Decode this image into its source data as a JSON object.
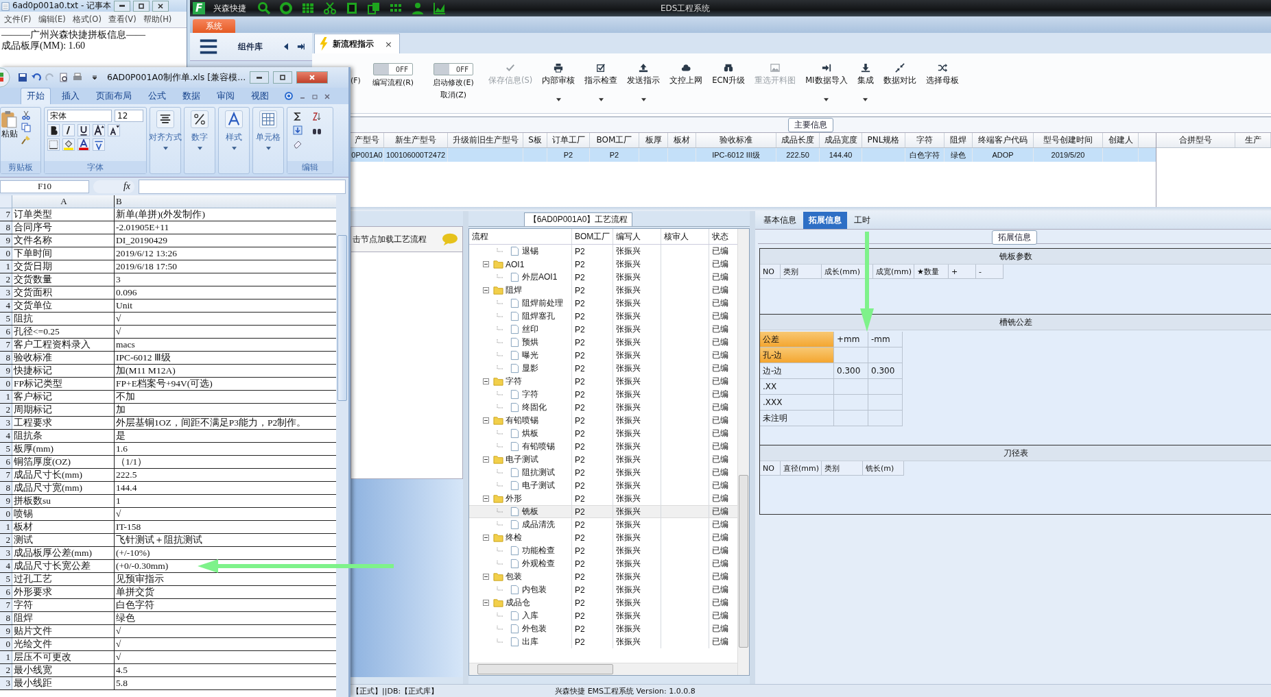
{
  "notepad": {
    "title": "6ad0p001a0.txt - 记事本",
    "menu": [
      "文件(F)",
      "编辑(E)",
      "格式(O)",
      "查看(V)",
      "帮助(H)"
    ],
    "lines": [
      "———广州兴森快捷拼板信息——",
      "成品板厚(MM): 1.60"
    ]
  },
  "app": {
    "logo": "F",
    "brand": "兴森快捷",
    "title": "EDS工程系统",
    "system_tab": "系统",
    "panel_title": "组件库",
    "doc_tab": {
      "label": "新流程指示",
      "close": "×"
    }
  },
  "toolbar": {
    "cut_label": "(F)",
    "toggles": [
      {
        "state": "OFF",
        "on": false,
        "lines": [
          "编写流程(R)"
        ]
      },
      {
        "state": "OFF",
        "on": false,
        "lines": [
          "启动修改(E)",
          "取消(Z)"
        ]
      }
    ],
    "buttons": [
      {
        "label": "保存信息(S)",
        "disabled": true,
        "dropdown": false
      },
      {
        "label": "内部审核",
        "disabled": false,
        "dropdown": true
      },
      {
        "label": "指示检查",
        "disabled": false,
        "dropdown": true
      },
      {
        "label": "发送指示",
        "disabled": false,
        "dropdown": true
      },
      {
        "label": "文控上网",
        "disabled": false,
        "dropdown": false
      },
      {
        "label": "ECN升级",
        "disabled": false,
        "dropdown": false
      },
      {
        "label": "重选开料图",
        "disabled": true,
        "dropdown": false
      },
      {
        "label": "MI数据导入",
        "disabled": false,
        "dropdown": true
      },
      {
        "label": "集成",
        "disabled": false,
        "dropdown": true
      },
      {
        "label": "数据对比",
        "disabled": false,
        "dropdown": false
      },
      {
        "label": "选择母板",
        "disabled": false,
        "dropdown": false
      }
    ]
  },
  "main_info": {
    "title": "主要信息",
    "columns": [
      "产型号",
      "新生产型号",
      "升级前旧生产型号",
      "S板",
      "订单工厂",
      "BOM工厂",
      "板厚",
      "板材",
      "验收标准",
      "成品长度",
      "成品宽度",
      "PNL规格",
      "字符",
      "阻焊",
      "终端客户代码",
      "型号创建时间",
      "创建人"
    ],
    "rows": [
      {
        "selected": true,
        "cells": [
          {
            "value": "0P001A0"
          },
          {
            "value": "100106000T2472"
          },
          {},
          {},
          {
            "value": "P2"
          },
          {
            "value": "P2"
          },
          {},
          {},
          {
            "value": "IPC-6012 III级"
          },
          {
            "value": "222.50"
          },
          {
            "value": "144.40"
          },
          {},
          {
            "value": "白色字符"
          },
          {
            "value": "绿色"
          },
          {
            "value": "ADOP"
          },
          {
            "value": "2019/5/20"
          },
          {}
        ]
      }
    ],
    "side_columns": [
      "合拼型号",
      "生产"
    ]
  },
  "flow_panel": {
    "hint": "击节点加载工艺流程",
    "title": "【6AD0P001A0】工艺流程",
    "columns": [
      "流程",
      "BOM工厂",
      "编写人",
      "核审人",
      "状态"
    ],
    "continued": [
      {
        "label": "退锡",
        "bom": "P2",
        "writer": "张振兴",
        "status": "已编",
        "selected": false
      }
    ],
    "nodes": [
      {
        "label": "AOI1",
        "bom": "P2",
        "writer": "张振兴",
        "status": "已编",
        "selected": false,
        "expanded": true,
        "children": [
          {
            "label": "外层AOI1",
            "bom": "P2",
            "writer": "张振兴",
            "status": "已编",
            "selected": false
          }
        ]
      },
      {
        "label": "阻焊",
        "bom": "P2",
        "writer": "张振兴",
        "status": "已编",
        "selected": false,
        "expanded": true,
        "children": [
          {
            "label": "阻焊前处理",
            "bom": "P2",
            "writer": "张振兴",
            "status": "已编",
            "selected": false
          },
          {
            "label": "阻焊塞孔",
            "bom": "P2",
            "writer": "张振兴",
            "status": "已编",
            "selected": false
          },
          {
            "label": "丝印",
            "bom": "P2",
            "writer": "张振兴",
            "status": "已编",
            "selected": false
          },
          {
            "label": "预烘",
            "bom": "P2",
            "writer": "张振兴",
            "status": "已编",
            "selected": false
          },
          {
            "label": "曝光",
            "bom": "P2",
            "writer": "张振兴",
            "status": "已编",
            "selected": false
          },
          {
            "label": "显影",
            "bom": "P2",
            "writer": "张振兴",
            "status": "已编",
            "selected": false
          }
        ]
      },
      {
        "label": "字符",
        "bom": "P2",
        "writer": "张振兴",
        "status": "已编",
        "selected": false,
        "expanded": true,
        "children": [
          {
            "label": "字符",
            "bom": "P2",
            "writer": "张振兴",
            "status": "已编",
            "selected": false
          },
          {
            "label": "终固化",
            "bom": "P2",
            "writer": "张振兴",
            "status": "已编",
            "selected": false
          }
        ]
      },
      {
        "label": "有铅喷锡",
        "bom": "P2",
        "writer": "张振兴",
        "status": "已编",
        "selected": false,
        "expanded": true,
        "children": [
          {
            "label": "烘板",
            "bom": "P2",
            "writer": "张振兴",
            "status": "已编",
            "selected": false
          },
          {
            "label": "有铅喷锡",
            "bom": "P2",
            "writer": "张振兴",
            "status": "已编",
            "selected": false
          }
        ]
      },
      {
        "label": "电子测试",
        "bom": "P2",
        "writer": "张振兴",
        "status": "已编",
        "selected": false,
        "expanded": true,
        "children": [
          {
            "label": "阻抗测试",
            "bom": "P2",
            "writer": "张振兴",
            "status": "已编",
            "selected": false
          },
          {
            "label": "电子测试",
            "bom": "P2",
            "writer": "张振兴",
            "status": "已编",
            "selected": false
          }
        ]
      },
      {
        "label": "外形",
        "bom": "P2",
        "writer": "张振兴",
        "status": "已编",
        "selected": false,
        "expanded": true,
        "children": [
          {
            "label": "铣板",
            "bom": "P2",
            "writer": "张振兴",
            "status": "已编",
            "selected": true
          },
          {
            "label": "成品清洗",
            "bom": "P2",
            "writer": "张振兴",
            "status": "已编",
            "selected": false
          }
        ]
      },
      {
        "label": "终检",
        "bom": "P2",
        "writer": "张振兴",
        "status": "已编",
        "selected": false,
        "expanded": true,
        "children": [
          {
            "label": "功能检查",
            "bom": "P2",
            "writer": "张振兴",
            "status": "已编",
            "selected": false
          },
          {
            "label": "外观检查",
            "bom": "P2",
            "writer": "张振兴",
            "status": "已编",
            "selected": false
          }
        ]
      },
      {
        "label": "包装",
        "bom": "P2",
        "writer": "张振兴",
        "status": "已编",
        "selected": false,
        "expanded": true,
        "children": [
          {
            "label": "内包装",
            "bom": "P2",
            "writer": "张振兴",
            "status": "已编",
            "selected": false
          }
        ]
      },
      {
        "label": "成品仓",
        "bom": "P2",
        "writer": "张振兴",
        "status": "已编",
        "selected": false,
        "expanded": true,
        "children": [
          {
            "label": "入库",
            "bom": "P2",
            "writer": "张振兴",
            "status": "已编",
            "selected": false
          },
          {
            "label": "外包装",
            "bom": "P2",
            "writer": "张振兴",
            "status": "已编",
            "selected": false
          },
          {
            "label": "出库",
            "bom": "P2",
            "writer": "张振兴",
            "status": "已编",
            "selected": false
          }
        ]
      }
    ]
  },
  "detail": {
    "tabs": [
      {
        "label": "基本信息",
        "selected": false
      },
      {
        "label": "拓展信息",
        "selected": true
      },
      {
        "label": "工时",
        "selected": false
      }
    ],
    "group": "拓展信息",
    "sections": [
      {
        "kind": "grid",
        "title": "铣板参数",
        "columns": [
          "NO",
          "类别",
          "成长(mm)",
          "成宽(mm)",
          "★数量",
          "+",
          "-"
        ]
      },
      {
        "kind": "tolerance",
        "title": "槽铣公差",
        "columns": [
          "公差",
          "+mm",
          "-mm"
        ],
        "rows": [
          {
            "label": "孔-边",
            "selected": true
          },
          {
            "label": "边-边",
            "selected": false,
            "plus": "0.300",
            "minus": "0.300"
          },
          {
            "label": ".XX",
            "selected": false
          },
          {
            "label": ".XXX",
            "selected": false
          },
          {
            "label": "未注明",
            "selected": false
          }
        ]
      },
      {
        "kind": "grid",
        "title": "刀径表",
        "columns": [
          "NO",
          "直径(mm)",
          "类别",
          "铣长(m)"
        ]
      }
    ]
  },
  "status_bar": {
    "left": "【正式】||DB:【正式库】",
    "center": "兴森快捷 EMS工程系统 Version: 1.0.0.8"
  },
  "excel": {
    "title": "6AD0P001A0制作单.xls  [兼容模...",
    "tabs": [
      {
        "label": "开始",
        "selected": true
      },
      {
        "label": "插入",
        "selected": false
      },
      {
        "label": "页面布局",
        "selected": false
      },
      {
        "label": "公式",
        "selected": false
      },
      {
        "label": "数据",
        "selected": false
      },
      {
        "label": "审阅",
        "selected": false
      },
      {
        "label": "视图",
        "selected": false
      }
    ],
    "paste": "粘贴",
    "font": "宋体",
    "size": "12",
    "group_labels": [
      "剪贴板",
      "字体",
      "编辑"
    ],
    "big_buttons": [
      "对齐方式",
      "数字",
      "样式",
      "单元格"
    ],
    "cell_ref": "F10",
    "fx": "fx",
    "col_headers": [
      "A",
      "B"
    ],
    "rows": [
      {
        "n": "7",
        "a": "订单类型",
        "b": "新单(单拼)(外发制作)"
      },
      {
        "n": "8",
        "a": "合同序号",
        "b": "-2.01905E+11"
      },
      {
        "n": "9",
        "a": "文件名称",
        "b": "DI_20190429"
      },
      {
        "n": "0",
        "a": "下单时间",
        "b": "2019/6/12 13:26"
      },
      {
        "n": "1",
        "a": "交货日期",
        "b": "2019/6/18 17:50"
      },
      {
        "n": "2",
        "a": "交货数量",
        "b": "3"
      },
      {
        "n": "3",
        "a": "交货面积",
        "b": "0.096"
      },
      {
        "n": "4",
        "a": "交货单位",
        "b": "Unit"
      },
      {
        "n": "5",
        "a": "阻抗",
        "b": "√"
      },
      {
        "n": "6",
        "a": "孔径<=0.25",
        "b": "√"
      },
      {
        "n": "7",
        "a": "客户工程资料录入",
        "b": "macs"
      },
      {
        "n": "8",
        "a": "验收标准",
        "b": "IPC-6012 Ⅲ级"
      },
      {
        "n": "9",
        "a": "快捷标记",
        "b": "加(M11 M12A)"
      },
      {
        "n": "0",
        "a": "FP标记类型",
        "b": "FP+E档案号+94V(可选)"
      },
      {
        "n": "1",
        "a": "客户标记",
        "b": "不加"
      },
      {
        "n": "2",
        "a": "周期标记",
        "b": "加"
      },
      {
        "n": "3",
        "a": "工程要求",
        "b": "外层基铜1OZ，间距不满足P3能力，P2制作。"
      },
      {
        "n": "4",
        "a": "阻抗条",
        "b": "是"
      },
      {
        "n": "5",
        "a": "板厚(mm)",
        "b": "1.6"
      },
      {
        "n": "6",
        "a": "铜箔厚度(OZ)",
        "b": "（1/1）"
      },
      {
        "n": "7",
        "a": "成品尺寸长(mm)",
        "b": "222.5"
      },
      {
        "n": "8",
        "a": "成品尺寸宽(mm)",
        "b": "144.4"
      },
      {
        "n": "9",
        "a": "拼板数su",
        "b": "1"
      },
      {
        "n": "0",
        "a": "喷锡",
        "b": "√"
      },
      {
        "n": "1",
        "a": "板材",
        "b": "IT-158"
      },
      {
        "n": "2",
        "a": "测试",
        "b": "飞针测试＋阻抗测试"
      },
      {
        "n": "3",
        "a": "成品板厚公差(mm)",
        "b": "(+/-10%)"
      },
      {
        "n": "4",
        "a": "成品尺寸长宽公差",
        "b": "(+0/-0.30mm)"
      },
      {
        "n": "5",
        "a": "过孔工艺",
        "b": "见预审指示"
      },
      {
        "n": "6",
        "a": "外形要求",
        "b": "单拼交货"
      },
      {
        "n": "7",
        "a": "字符",
        "b": "白色字符"
      },
      {
        "n": "8",
        "a": "阻焊",
        "b": "绿色"
      },
      {
        "n": "9",
        "a": "贴片文件",
        "b": "√"
      },
      {
        "n": "0",
        "a": "光绘文件",
        "b": "√"
      },
      {
        "n": "1",
        "a": "层压不可更改",
        "b": "√"
      },
      {
        "n": "2",
        "a": "最小线宽",
        "b": "4.5"
      },
      {
        "n": "3",
        "a": "最小线距",
        "b": "5.8"
      }
    ]
  }
}
